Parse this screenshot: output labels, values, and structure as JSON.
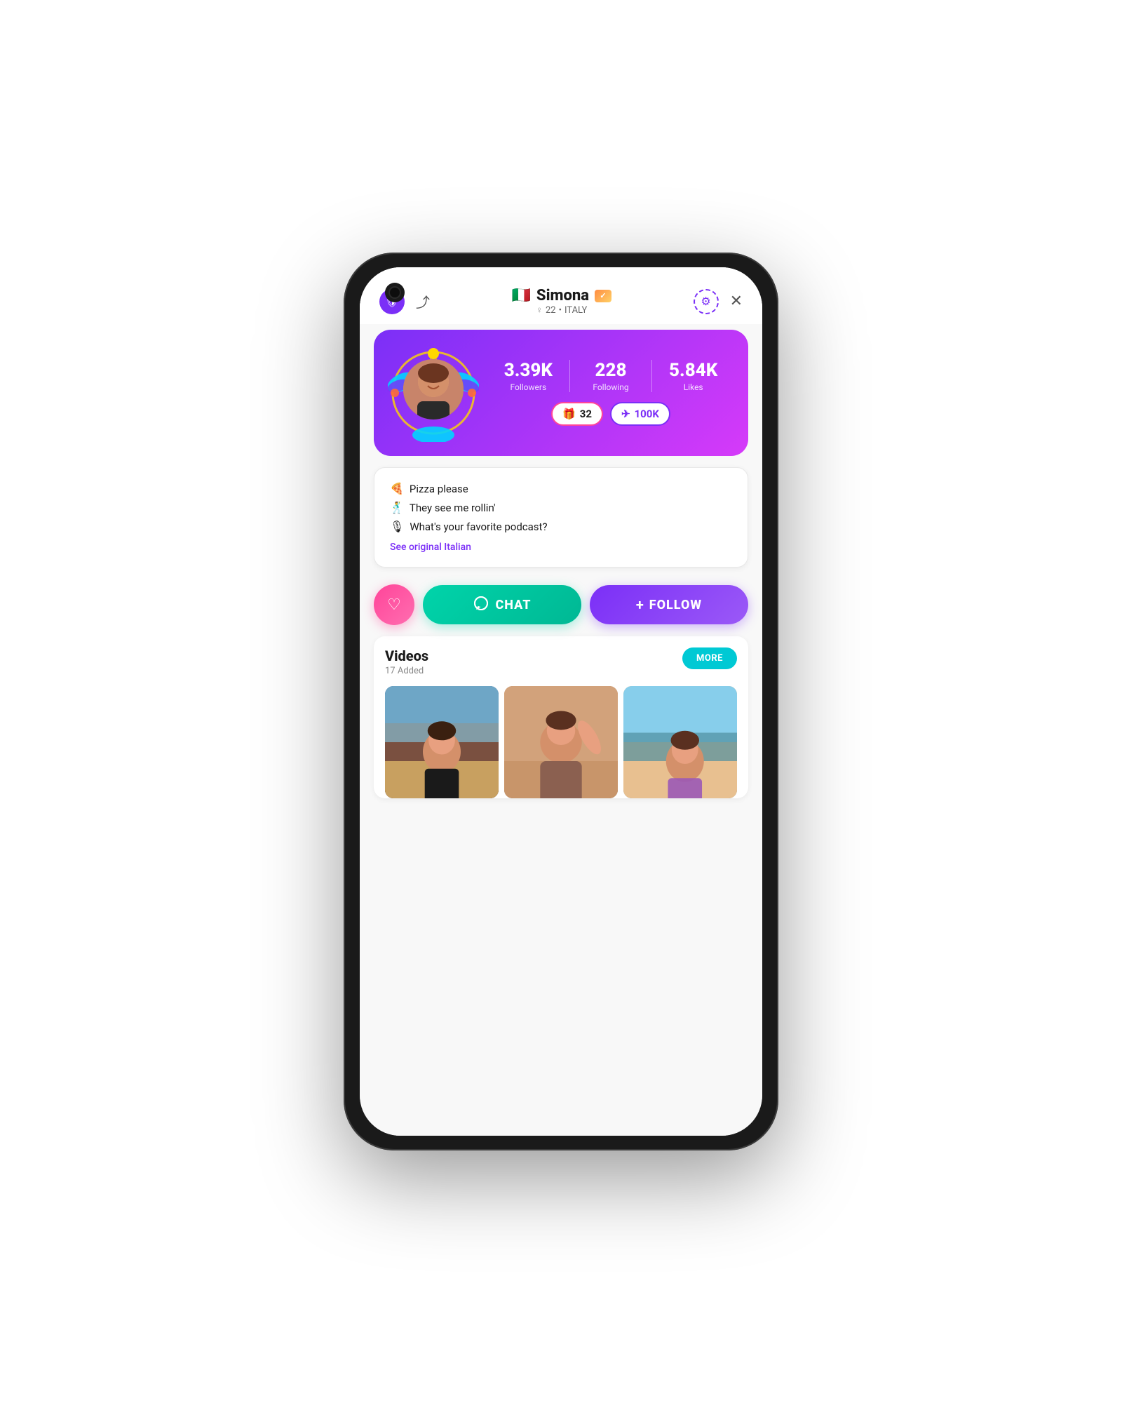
{
  "phone": {
    "screen": {
      "header": {
        "shield_label": "!",
        "share_label": "⤴",
        "username": "Simona",
        "flag": "🇮🇹",
        "verified_badge": "✓",
        "gender_symbol": "♀",
        "age": "22",
        "country": "ITALY",
        "settings_label": "⚙",
        "close_label": "✕"
      },
      "stats_banner": {
        "followers_value": "3.39K",
        "followers_label": "Followers",
        "following_value": "228",
        "following_label": "Following",
        "likes_value": "5.84K",
        "likes_label": "Likes",
        "gifts_badge": "32",
        "gifts_icon": "🎁",
        "coins_badge": "100K",
        "coins_icon": "✈"
      },
      "bio": {
        "line1_emoji": "🍕",
        "line1_text": "Pizza please",
        "line2_emoji": "🕺",
        "line2_text": "They see me rollin'",
        "line3_emoji": "🎙",
        "line3_text": "What's your favorite podcast?",
        "translate_link": "See original Italian"
      },
      "actions": {
        "like_icon": "♡",
        "chat_label": "CHAT",
        "chat_icon": "◯",
        "follow_label": "FOLLOW",
        "follow_plus": "+"
      },
      "videos": {
        "title": "Videos",
        "count_label": "17 Added",
        "more_button": "MORE",
        "thumbnails": [
          {
            "id": 1,
            "alt": "video-thumb-1"
          },
          {
            "id": 2,
            "alt": "video-thumb-2"
          },
          {
            "id": 3,
            "alt": "video-thumb-3"
          }
        ]
      }
    }
  },
  "colors": {
    "brand_purple": "#7b2ff7",
    "brand_teal": "#00d4aa",
    "brand_pink": "#ff4499",
    "stats_bg_start": "#7b2ff7",
    "stats_bg_end": "#d63af9"
  }
}
